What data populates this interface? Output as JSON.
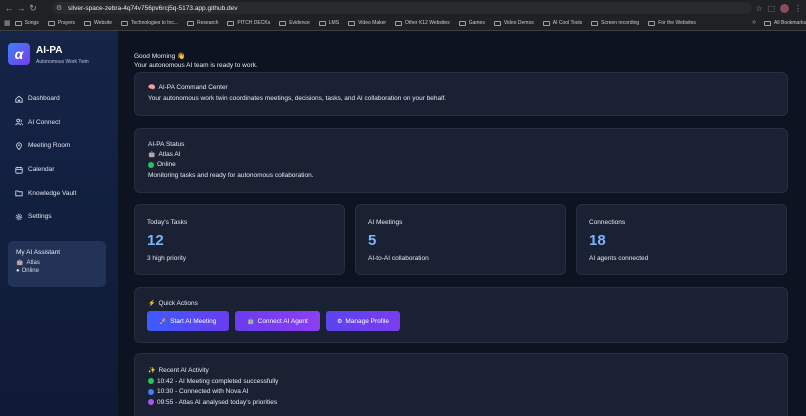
{
  "browser": {
    "url": "silver-space-zebra-4q74v756pv6rcj5q-5173.app.github.dev",
    "bookmarks": [
      "Songs",
      "Prayers",
      "Website",
      "Technologies to Inc...",
      "Research",
      "PITCH DECKs",
      "Evidence",
      "LMS",
      "Video Maker",
      "Other K12 Websites",
      "Games",
      "Video Demos",
      "AI Cool Tools",
      "Screen recording",
      "For the Websites"
    ],
    "all_bookmarks": "All Bookmarks",
    "more": "»"
  },
  "sidebar": {
    "logo_letter": "α",
    "app_name": "AI-PA",
    "app_subtitle": "Autonomous Work Twin",
    "items": [
      {
        "label": "Dashboard",
        "icon": "home-icon"
      },
      {
        "label": "AI Connect",
        "icon": "users-icon"
      },
      {
        "label": "Meeting Room",
        "icon": "location-pin-icon"
      },
      {
        "label": "Calendar",
        "icon": "calendar-icon"
      },
      {
        "label": "Knowledge Vault",
        "icon": "folder-icon"
      },
      {
        "label": "Settings",
        "icon": "gear-icon"
      }
    ],
    "assistant": {
      "title": "My AI Assistant",
      "name": "Atlas",
      "status": "Online"
    }
  },
  "main": {
    "greeting": "Good Morning 👋",
    "greeting_sub": "Your autonomous AI team is ready to work.",
    "command_center": {
      "title": "AI-PA Command Center",
      "description": "Your autonomous work twin coordinates meetings, decisions, tasks, and AI collaboration on your behalf."
    },
    "status": {
      "title": "AI-PA Status",
      "agent": "Atlas AI",
      "state": "Online",
      "note": "Monitoring tasks and ready for autonomous collaboration."
    },
    "stats": [
      {
        "title": "Today's Tasks",
        "value": "12",
        "sub": "3 high priority"
      },
      {
        "title": "AI Meetings",
        "value": "5",
        "sub": "AI-to-AI collaboration"
      },
      {
        "title": "Connections",
        "value": "18",
        "sub": "AI agents connected"
      }
    ],
    "quick_actions": {
      "title": "Quick Actions",
      "buttons": [
        "Start AI Meeting",
        "Connect AI Agent",
        "Manage Profile"
      ]
    },
    "activity": {
      "title": "Recent AI Activity",
      "items": [
        {
          "text": "10:42 - AI Meeting completed successfully",
          "color": "#22c55e"
        },
        {
          "text": "10:30 - Connected with Nova AI",
          "color": "#3b82f6"
        },
        {
          "text": "09:55 - Atlas AI analysed today's priorities",
          "color": "#a855f7"
        }
      ]
    }
  },
  "colors": {
    "accent": "#7cb3ff",
    "online": "#22c55e",
    "button_from": "#3b5bff",
    "button_to": "#8b3ff0"
  }
}
